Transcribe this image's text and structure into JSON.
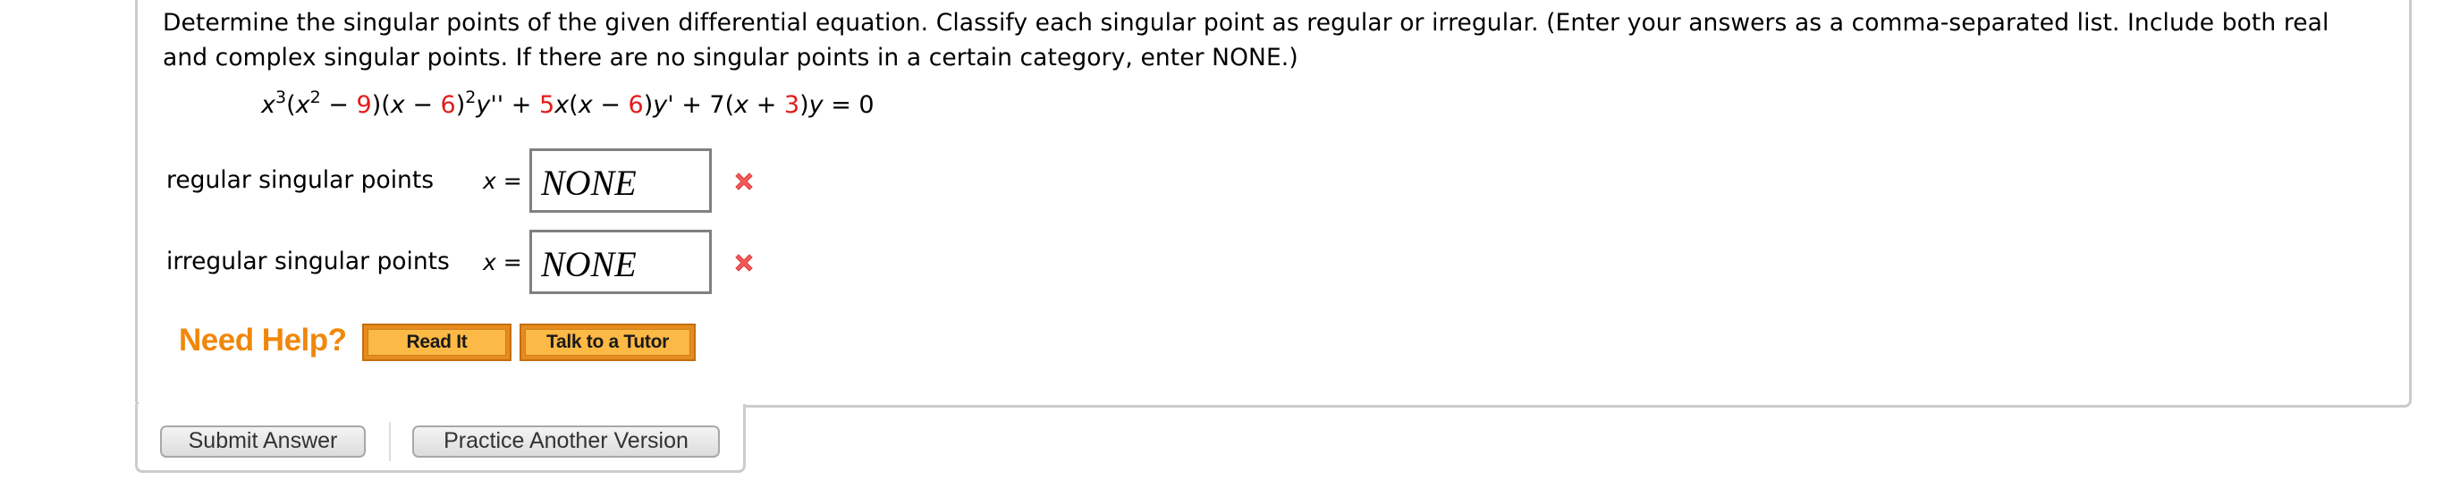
{
  "question": {
    "instructions": "Determine the singular points of the given differential equation. Classify each singular point as regular or irregular. (Enter your answers as a comma-separated list. Include both real and complex singular points. If there are no singular points in a certain category, enter NONE.)",
    "equation": {
      "t1": "x",
      "t1_sup": "3",
      "t2": "(",
      "t3": "x",
      "t3_sup": "2",
      "t4": " − ",
      "c1": "9",
      "t5": ")(",
      "t6": "x",
      "t7": " − ",
      "c2": "6",
      "t8": ")",
      "t8_sup": "2",
      "t9": "y''",
      "t10": " + ",
      "c3": "5",
      "t11": "x",
      "t12": "(",
      "t13": "x",
      "t14": " − ",
      "c4": "6",
      "t15": ")",
      "t16": "y'",
      "t17": " + 7(",
      "t18": "x",
      "t19": " + ",
      "c5": "3",
      "t20": ")",
      "t21": "y",
      "t22": " = 0"
    }
  },
  "answers": [
    {
      "label": "regular singular points",
      "var": "x",
      "eq": " =",
      "value": "NONE",
      "status": "incorrect",
      "status_icon": "red-x-icon"
    },
    {
      "label": "irregular singular points",
      "var": "x",
      "eq": " =",
      "value": "NONE",
      "status": "incorrect",
      "status_icon": "red-x-icon"
    }
  ],
  "help": {
    "title": "Need Help?",
    "read_it": "Read It",
    "tutor": "Talk to a Tutor"
  },
  "footer": {
    "submit": "Submit Answer",
    "practice": "Practice Another Version"
  },
  "colors": {
    "coefficient_red": "#e31b1b",
    "help_orange": "#f0870a",
    "incorrect_red": "#f05050"
  }
}
